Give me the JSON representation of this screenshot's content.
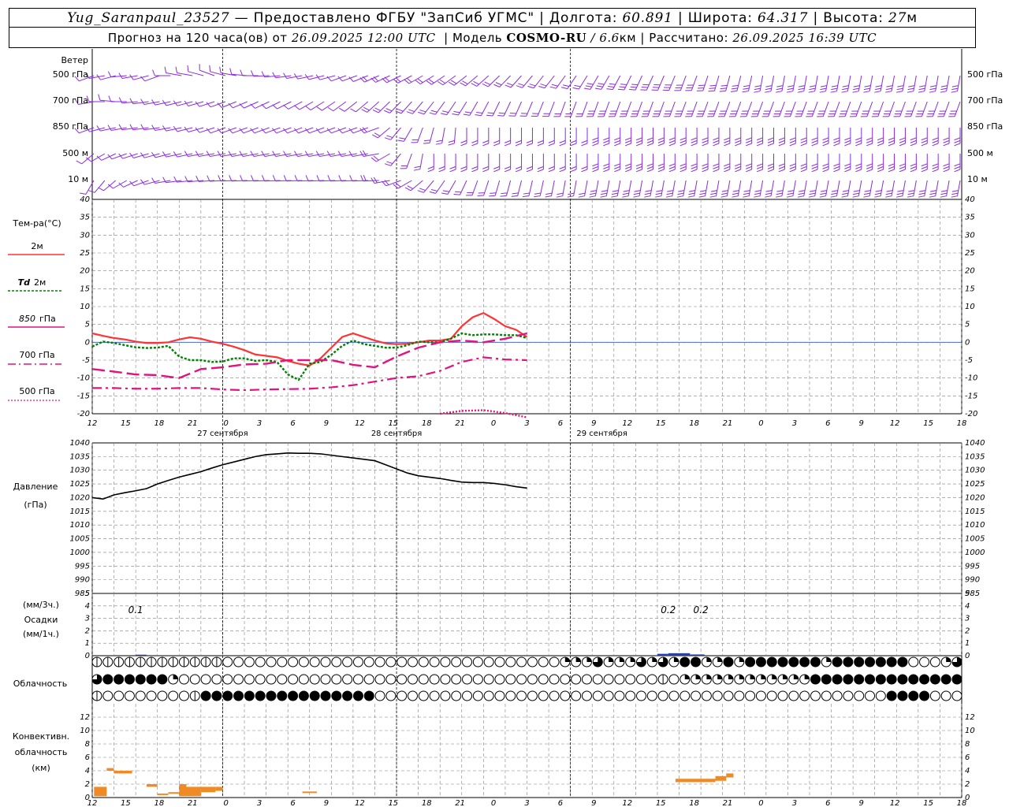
{
  "header": {
    "station": "Yug_Saranpaul_23527",
    "provided": "— Предоставлено ФГБУ \"ЗапСиб УГМС\"",
    "lon_label": "| Долгота:",
    "lon": "60.891",
    "lat_label": "| Широта:",
    "lat": "64.317",
    "alt_label": "| Высота:",
    "alt": "27",
    "alt_unit": "м",
    "forecast": "Прогноз на 120 часа(ов) от",
    "forecast_start": "26.09.2025 12:00 UTC",
    "model_label": "| Модель",
    "model": "COSMO-RU",
    "res": "/ 6.6",
    "res_unit": "км",
    "calc_label": "| Рассчитано:",
    "calc": "26.09.2025 16:39 UTC"
  },
  "colors": {
    "wind": "#8a2be2",
    "t2m": "#ff3333",
    "td2m": "#008000",
    "t850": "#e0147f",
    "t700": "#e0147f",
    "t500": "#e0147f",
    "precip": "#1f3fbf",
    "conv": "#f08a24",
    "grid": "#808080"
  },
  "panels": {
    "wind": {
      "title": "Ветер",
      "levels": [
        "500 гПа",
        "700 гПа",
        "850 гПа",
        "500 м",
        "10 м"
      ]
    },
    "temp": {
      "title": "Тем-ра(°C)",
      "legend": [
        {
          "key": "t2m",
          "label": "2м"
        },
        {
          "key": "td2m",
          "label_it": "Td",
          "label": "2м"
        },
        {
          "key": "t850",
          "label_it": "850",
          "label": "гПа"
        },
        {
          "key": "t700",
          "label": "700 гПа"
        },
        {
          "key": "t500",
          "label": "500 гПа"
        }
      ]
    },
    "pressure": {
      "title": "Давление",
      "unit": "(гПа)"
    },
    "precip": {
      "unit3h": "(мм/3ч.)",
      "title": "Осадки",
      "unit1h": "(мм/1ч.)"
    },
    "cloud": {
      "title": "Облачность"
    },
    "conv": {
      "title1": "Конвективн.",
      "title2": "облачность",
      "unit": "(км)"
    }
  },
  "x_axis": {
    "hours": [
      "12",
      "15",
      "18",
      "21",
      "0",
      "3",
      "6",
      "9",
      "12",
      "15",
      "18",
      "21",
      "0",
      "3",
      "6",
      "9",
      "12",
      "15",
      "18",
      "21",
      "0",
      "3",
      "6",
      "9",
      "12",
      "15",
      "18"
    ],
    "days": [
      "27 сентября",
      "28 сентября",
      "29 сентября"
    ]
  },
  "chart_data": [
    {
      "type": "line",
      "title": "Тем-ра(°C)",
      "x_hours_from_start": [
        0,
        3,
        6,
        9,
        12,
        15,
        18,
        21,
        24,
        27,
        30,
        33,
        36,
        39,
        42,
        45,
        48,
        51,
        54,
        57,
        60,
        63,
        66,
        69,
        72,
        75,
        78,
        81,
        84,
        87,
        90,
        93,
        96,
        99,
        102,
        105,
        108,
        111,
        114,
        117,
        120,
        123,
        126,
        129,
        132,
        135,
        138,
        141,
        144,
        147,
        150,
        153,
        156,
        159,
        162,
        165,
        168,
        171,
        174,
        177,
        180,
        183,
        186,
        189,
        192,
        195,
        198,
        201,
        204,
        207,
        210,
        213,
        216,
        219,
        222,
        225,
        228,
        231,
        234,
        237,
        240
      ],
      "ylim": [
        -20,
        40
      ],
      "yticks": [
        -20,
        -15,
        -10,
        -5,
        0,
        5,
        10,
        15,
        20,
        25,
        30,
        35,
        40
      ],
      "series": [
        {
          "name": "2м",
          "key": "t2m",
          "x": [
            0,
            6,
            12,
            18,
            24,
            30,
            36,
            42,
            48,
            54,
            60,
            66,
            72,
            78,
            84,
            90,
            96,
            102,
            108,
            114,
            120,
            126,
            132,
            138,
            144,
            150,
            156,
            162,
            168,
            174,
            180,
            186,
            192,
            198,
            204,
            210,
            216,
            222,
            228,
            234,
            240
          ],
          "values": [
            2.5,
            1.8,
            1.2,
            0.8,
            0.2,
            -0.2,
            -0.2,
            0,
            0.8,
            1.4,
            1,
            0.2,
            -0.4,
            -1.2,
            -2.2,
            -3.4,
            -3.8,
            -4.2,
            -5.2,
            -6,
            -6.5,
            -4.5,
            -1.5,
            1.5,
            2.5,
            1.5,
            0.5,
            -0.3,
            -0.5,
            -0.4,
            0,
            0.5,
            0.5,
            1,
            4.5,
            7,
            8.2,
            6.5,
            4.5,
            3.5,
            1.5
          ]
        },
        {
          "name": "Td 2м",
          "key": "td2m",
          "x": [
            0,
            6,
            12,
            18,
            24,
            30,
            36,
            42,
            48,
            54,
            60,
            66,
            72,
            78,
            84,
            90,
            96,
            102,
            108,
            114,
            120,
            126,
            132,
            138,
            144,
            150,
            156,
            162,
            168,
            174,
            180,
            186,
            192,
            198,
            204,
            210,
            216,
            222,
            228,
            234,
            240
          ],
          "values": [
            -1.2,
            0.2,
            -0.2,
            -0.8,
            -1.4,
            -1.6,
            -1.5,
            -1,
            -4,
            -5,
            -5,
            -5.5,
            -5.4,
            -4.5,
            -4.5,
            -5.2,
            -5,
            -5.5,
            -9,
            -10.5,
            -6,
            -5.5,
            -3.5,
            -1,
            0.5,
            -0.5,
            -1,
            -1.5,
            -1.5,
            -0.8,
            0.2,
            0,
            0,
            1,
            2.5,
            2,
            2.2,
            2.2,
            2,
            2,
            1.2
          ]
        },
        {
          "name": "850 гПа",
          "key": "t850",
          "x": [
            0,
            12,
            24,
            36,
            48,
            60,
            72,
            84,
            96,
            108,
            120,
            132,
            144,
            156,
            168,
            180,
            192,
            204,
            216,
            228,
            240
          ],
          "values": [
            -7.5,
            -8.2,
            -9,
            -9.2,
            -10,
            -7.5,
            -7,
            -6.2,
            -6,
            -5,
            -5,
            -5,
            -6.3,
            -7,
            -4,
            -1.5,
            0,
            0.5,
            0,
            1,
            2.5
          ]
        },
        {
          "name": "700 гПа",
          "key": "t700",
          "x": [
            0,
            12,
            24,
            36,
            48,
            60,
            72,
            84,
            96,
            108,
            120,
            132,
            144,
            156,
            168,
            180,
            192,
            204,
            216,
            228,
            240
          ],
          "values": [
            -12.8,
            -12.8,
            -13,
            -13,
            -12.8,
            -12.8,
            -13.2,
            -13.4,
            -13.2,
            -13.1,
            -13,
            -12.6,
            -12,
            -11,
            -10,
            -9.5,
            -8,
            -5.5,
            -4.2,
            -4.8,
            -5
          ]
        },
        {
          "name": "500 гПа",
          "key": "t500",
          "x": [
            192,
            204,
            216,
            228,
            240
          ],
          "values": [
            -20,
            -19.2,
            -19,
            -19.8,
            -21
          ]
        }
      ]
    },
    {
      "type": "line",
      "title": "Давление",
      "ylabel": "(гПа)",
      "ylim": [
        985,
        1040
      ],
      "yticks": [
        985,
        990,
        995,
        1000,
        1005,
        1010,
        1015,
        1020,
        1025,
        1030,
        1035,
        1040
      ],
      "series": [
        {
          "name": "Давление",
          "x": [
            0,
            6,
            12,
            18,
            24,
            30,
            36,
            42,
            48,
            54,
            60,
            66,
            72,
            78,
            84,
            90,
            96,
            102,
            108,
            114,
            120,
            126,
            132,
            138,
            144,
            150,
            156,
            162,
            168,
            174,
            180,
            186,
            192,
            198,
            204,
            210,
            216,
            222,
            228,
            234,
            240
          ],
          "values": [
            1020,
            1019.5,
            1021,
            1021.8,
            1022.5,
            1023.3,
            1025,
            1026.3,
            1027.5,
            1028.5,
            1029.5,
            1030.8,
            1032,
            1033,
            1034,
            1035,
            1035.7,
            1036,
            1036.3,
            1036.2,
            1036.2,
            1036,
            1035.5,
            1035,
            1034.5,
            1034,
            1033.5,
            1032,
            1030.5,
            1029,
            1028,
            1027.5,
            1027,
            1026.3,
            1025.7,
            1025.5,
            1025.5,
            1025.2,
            1024.7,
            1024,
            1023.5
          ]
        }
      ]
    },
    {
      "type": "bar",
      "title": "Осадки",
      "ylim": [
        0,
        5
      ],
      "yticks": [
        0,
        1,
        2,
        3,
        4,
        5
      ],
      "labels": [
        {
          "x": 12,
          "text": "0.1"
        },
        {
          "x": 159,
          "text": "0.2"
        },
        {
          "x": 168,
          "text": "0.2"
        }
      ],
      "bars": [
        {
          "x0": 12,
          "x1": 15,
          "value": 0.08
        },
        {
          "x0": 156,
          "x1": 159,
          "value": 0.15
        },
        {
          "x0": 159,
          "x1": 165,
          "value": 0.2
        },
        {
          "x0": 165,
          "x1": 169,
          "value": 0.1
        }
      ]
    },
    {
      "type": "bar",
      "title": "Конвективн. облачность",
      "ylabel": "(км)",
      "ylim": [
        0,
        14
      ],
      "yticks": [
        0,
        2,
        4,
        6,
        8,
        10,
        12
      ],
      "bars": [
        {
          "x0": 0.5,
          "x1": 4,
          "b": 0.2,
          "t": 1.6
        },
        {
          "x0": 4,
          "x1": 6,
          "b": 4.0,
          "t": 4.4
        },
        {
          "x0": 6,
          "x1": 11,
          "b": 3.6,
          "t": 4.0
        },
        {
          "x0": 15,
          "x1": 18,
          "b": 1.6,
          "t": 2.0
        },
        {
          "x0": 18,
          "x1": 21,
          "b": 0.4,
          "t": 0.6
        },
        {
          "x0": 21,
          "x1": 24,
          "b": 0.6,
          "t": 0.8
        },
        {
          "x0": 24,
          "x1": 26,
          "b": 0.2,
          "t": 2.0
        },
        {
          "x0": 26,
          "x1": 30,
          "b": 0.2,
          "t": 1.6
        },
        {
          "x0": 30,
          "x1": 34,
          "b": 0.8,
          "t": 1.6
        },
        {
          "x0": 34,
          "x1": 36,
          "b": 1.0,
          "t": 1.6
        },
        {
          "x0": 58,
          "x1": 62,
          "b": 0.7,
          "t": 0.9
        },
        {
          "x0": 161,
          "x1": 172,
          "b": 2.3,
          "t": 2.8
        },
        {
          "x0": 172,
          "x1": 175,
          "b": 2.5,
          "t": 3.2
        },
        {
          "x0": 175,
          "x1": 177,
          "b": 3.0,
          "t": 3.6
        }
      ]
    }
  ]
}
